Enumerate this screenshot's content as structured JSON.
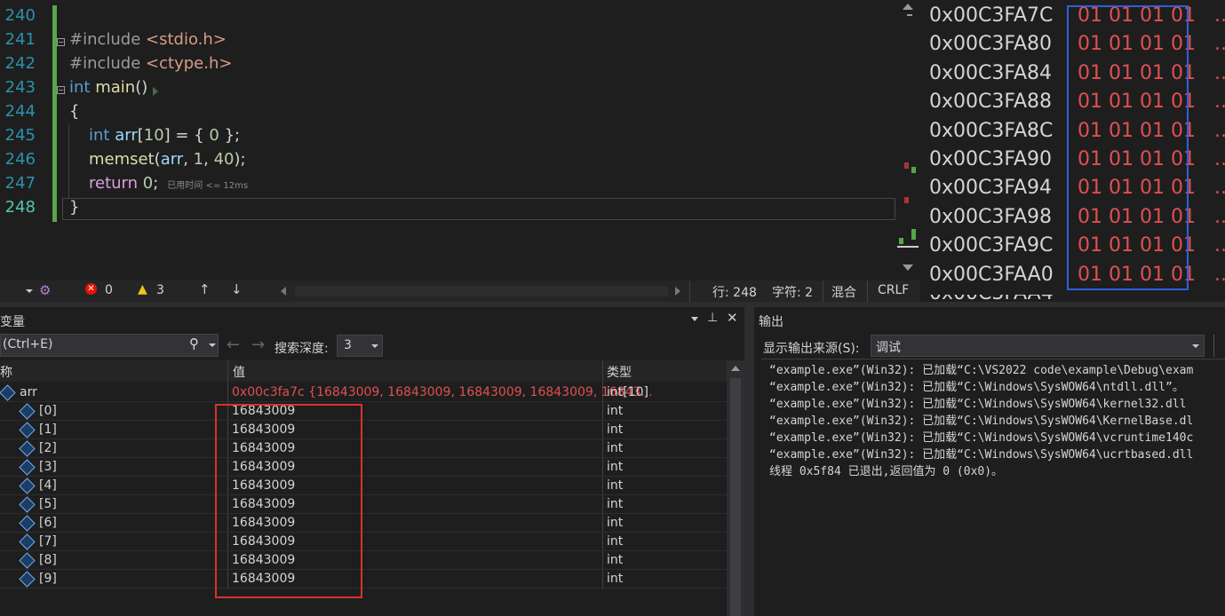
{
  "editor": {
    "lines": [
      {
        "num": "240"
      },
      {
        "num": "241",
        "tokens": [
          {
            "t": "#include ",
            "c": "pp"
          },
          {
            "t": "<stdio.h>",
            "c": "str"
          }
        ]
      },
      {
        "num": "242",
        "tokens": [
          {
            "t": "#include ",
            "c": "pp"
          },
          {
            "t": "<ctype.h>",
            "c": "str"
          }
        ]
      },
      {
        "num": "243",
        "tokens": [
          {
            "t": "int ",
            "c": "kw"
          },
          {
            "t": "main",
            "c": "fn"
          },
          {
            "t": "()",
            "c": "plain"
          }
        ]
      },
      {
        "num": "244",
        "tokens": [
          {
            "t": "{",
            "c": "plain"
          }
        ]
      },
      {
        "num": "245",
        "tokens": [
          {
            "t": "int ",
            "c": "kw"
          },
          {
            "t": "arr",
            "c": "var"
          },
          {
            "t": "[",
            "c": "plain"
          },
          {
            "t": "10",
            "c": "num"
          },
          {
            "t": "] = { ",
            "c": "plain"
          },
          {
            "t": "0",
            "c": "num"
          },
          {
            "t": " };",
            "c": "plain"
          }
        ]
      },
      {
        "num": "246",
        "tokens": [
          {
            "t": "memset",
            "c": "fn"
          },
          {
            "t": "(",
            "c": "plain"
          },
          {
            "t": "arr",
            "c": "var"
          },
          {
            "t": ", ",
            "c": "plain"
          },
          {
            "t": "1",
            "c": "num"
          },
          {
            "t": ", ",
            "c": "plain"
          },
          {
            "t": "40",
            "c": "num"
          },
          {
            "t": ");",
            "c": "plain"
          }
        ]
      },
      {
        "num": "247",
        "tokens": [
          {
            "t": "return ",
            "c": "ctl"
          },
          {
            "t": "0",
            "c": "num"
          },
          {
            "t": ";",
            "c": "plain"
          }
        ],
        "hint": "已用时间 <= 12ms"
      },
      {
        "num": "248",
        "tokens": [
          {
            "t": "}",
            "c": "plain"
          }
        ]
      }
    ]
  },
  "memory": {
    "rows": [
      {
        "addr": "0x00C3FA7C",
        "bytes": "01 01 01 01",
        "dots": "...."
      },
      {
        "addr": "0x00C3FA80",
        "bytes": "01 01 01 01",
        "dots": "...."
      },
      {
        "addr": "0x00C3FA84",
        "bytes": "01 01 01 01",
        "dots": "...."
      },
      {
        "addr": "0x00C3FA88",
        "bytes": "01 01 01 01",
        "dots": "...."
      },
      {
        "addr": "0x00C3FA8C",
        "bytes": "01 01 01 01",
        "dots": "...."
      },
      {
        "addr": "0x00C3FA90",
        "bytes": "01 01 01 01",
        "dots": "...."
      },
      {
        "addr": "0x00C3FA94",
        "bytes": "01 01 01 01",
        "dots": "...."
      },
      {
        "addr": "0x00C3FA98",
        "bytes": "01 01 01 01",
        "dots": "...."
      },
      {
        "addr": "0x00C3FA9C",
        "bytes": "01 01 01 01",
        "dots": "...."
      },
      {
        "addr": "0x00C3FAA0",
        "bytes": "01 01 01 01",
        "dots": "...."
      }
    ]
  },
  "status": {
    "errors": "0",
    "warnings": "3",
    "line": "行: 248",
    "char": "字符: 2",
    "mode": "混合",
    "eol": "CRLF"
  },
  "locals": {
    "title": "变量",
    "search_placeholder": "(Ctrl+E)",
    "depth_label": "搜索深度:",
    "depth_value": "3",
    "col_name": "称",
    "col_value": "值",
    "col_type": "类型",
    "root": {
      "name": "arr",
      "value": "0x00c3fa7c {16843009, 16843009, 16843009, 16843009, 16843...",
      "type": "int[10]"
    },
    "items": [
      {
        "name": "[0]",
        "value": "16843009",
        "type": "int"
      },
      {
        "name": "[1]",
        "value": "16843009",
        "type": "int"
      },
      {
        "name": "[2]",
        "value": "16843009",
        "type": "int"
      },
      {
        "name": "[3]",
        "value": "16843009",
        "type": "int"
      },
      {
        "name": "[4]",
        "value": "16843009",
        "type": "int"
      },
      {
        "name": "[5]",
        "value": "16843009",
        "type": "int"
      },
      {
        "name": "[6]",
        "value": "16843009",
        "type": "int"
      },
      {
        "name": "[7]",
        "value": "16843009",
        "type": "int"
      },
      {
        "name": "[8]",
        "value": "16843009",
        "type": "int"
      },
      {
        "name": "[9]",
        "value": "16843009",
        "type": "int"
      }
    ]
  },
  "output": {
    "title": "输出",
    "source_label": "显示输出来源(S):",
    "source_value": "调试",
    "lines": [
      "“example.exe”(Win32): 已加载“C:\\VS2022 code\\example\\Debug\\exam",
      "“example.exe”(Win32): 已加载“C:\\Windows\\SysWOW64\\ntdll.dll”。",
      "“example.exe”(Win32): 已加载“C:\\Windows\\SysWOW64\\kernel32.dll",
      "“example.exe”(Win32): 已加载“C:\\Windows\\SysWOW64\\KernelBase.dl",
      "“example.exe”(Win32): 已加载“C:\\Windows\\SysWOW64\\vcruntime140c",
      "“example.exe”(Win32): 已加载“C:\\Windows\\SysWOW64\\ucrtbased.dll",
      "线程 0x5f84 已退出,返回值为 0 (0x0)。"
    ]
  },
  "colors": {
    "memory_highlight_box": "#2f5fd9",
    "locals_highlight_box": "#d9322e",
    "changed_value": "#e05050"
  }
}
